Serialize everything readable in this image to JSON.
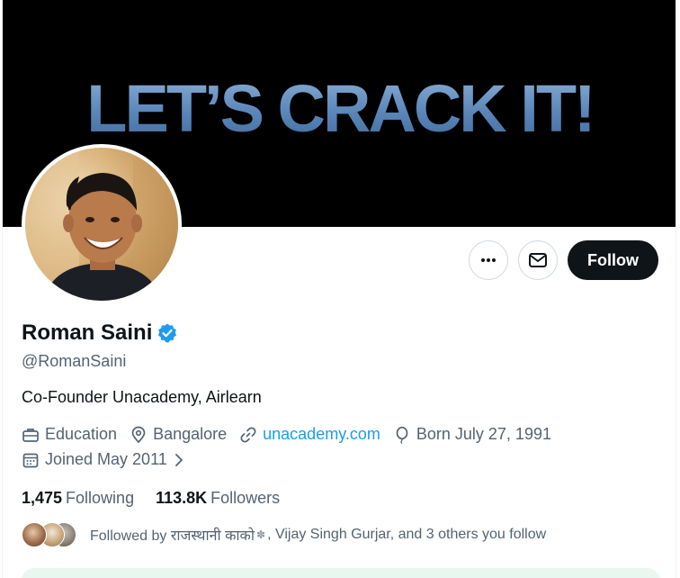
{
  "banner": {
    "text": "LET’S CRACK IT!"
  },
  "profile": {
    "name": "Roman Saini",
    "handle": "@RomanSaini",
    "bio": "Co-Founder Unacademy, Airlearn",
    "category": "Education",
    "location": "Bangalore",
    "website": "unacademy.com",
    "born": "Born July 27, 1991",
    "joined": "Joined May 2011"
  },
  "actions": {
    "follow_label": "Follow"
  },
  "stats": {
    "following_count": "1,475",
    "following_label": "Following",
    "followers_count": "113.8K",
    "followers_label": "Followers"
  },
  "followed_by": {
    "prefix": "Followed by राजस्थानी काको",
    "suffix": ", Vijay Singh Gurjar, and 3 others you follow"
  },
  "colors": {
    "accent": "#1d9bf0",
    "button_dark": "#0f1419",
    "muted": "#536471"
  }
}
